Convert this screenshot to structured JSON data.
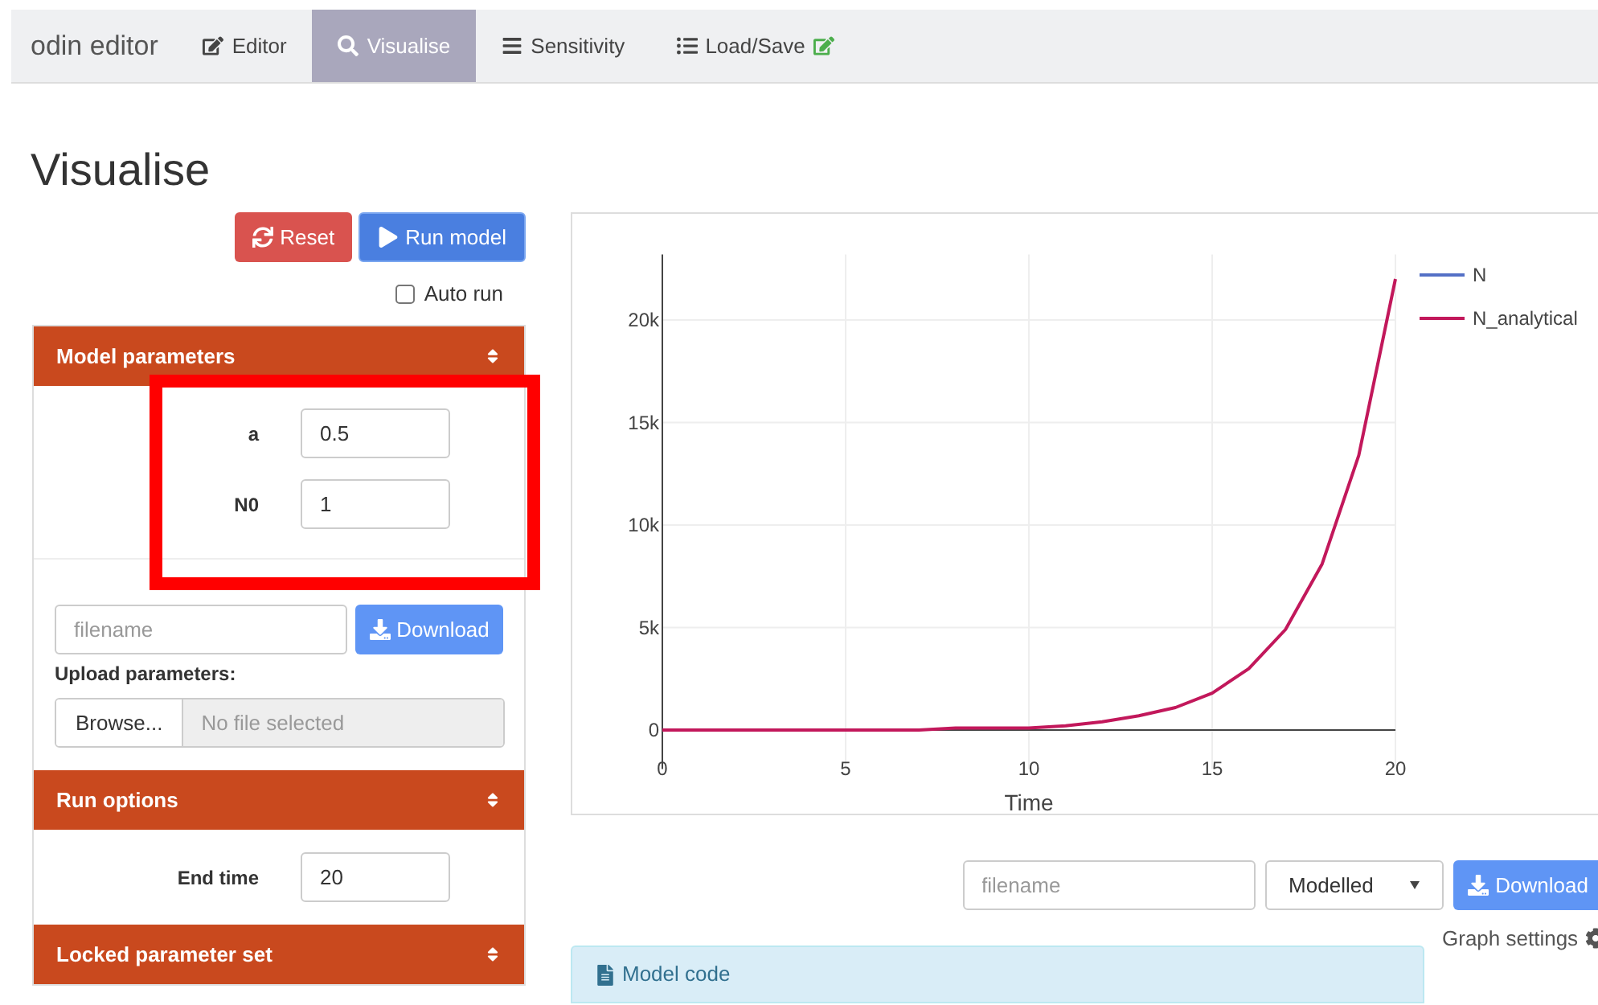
{
  "navbar": {
    "brand": "odin editor",
    "tabs": [
      {
        "label": "Editor",
        "selected": false
      },
      {
        "label": "Visualise",
        "selected": true
      },
      {
        "label": "Sensitivity",
        "selected": false
      },
      {
        "label": "Load/Save",
        "selected": false
      }
    ]
  },
  "page_title": "Visualise",
  "controls": {
    "reset": "Reset",
    "run": "Run model",
    "auto_run": {
      "label": "Auto run",
      "checked": false
    }
  },
  "model_parameters": {
    "title": "Model parameters",
    "params": [
      {
        "name": "a",
        "value": "0.5"
      },
      {
        "name": "N0",
        "value": "1"
      }
    ],
    "filename_placeholder": "filename",
    "download": "Download",
    "upload_label": "Upload parameters:",
    "browse": "Browse...",
    "no_file": "No file selected"
  },
  "run_options": {
    "title": "Run options",
    "end_time_label": "End time",
    "end_time": "20"
  },
  "locked_parameter_set": {
    "title": "Locked parameter set"
  },
  "chart_data": {
    "type": "line",
    "xlabel": "Time",
    "xlim": [
      0,
      20
    ],
    "ylim": [
      -1900,
      23200
    ],
    "grid": true,
    "legend": "right",
    "x": [
      0,
      1,
      2,
      3,
      4,
      5,
      6,
      7,
      8,
      9,
      10,
      11,
      12,
      13,
      14,
      15,
      16,
      17,
      18,
      19,
      20
    ],
    "xticks": [
      0,
      5,
      10,
      15,
      20
    ],
    "yticks": [
      {
        "value": 0,
        "label": "0"
      },
      {
        "value": 5000,
        "label": "5k"
      },
      {
        "value": 10000,
        "label": "10k"
      },
      {
        "value": 15000,
        "label": "15k"
      },
      {
        "value": 20000,
        "label": "20k"
      }
    ],
    "series": [
      {
        "name": "N",
        "color": "#5470c6",
        "values": [
          null,
          null,
          null,
          null,
          null,
          null,
          null,
          null,
          null,
          null,
          null,
          null,
          null,
          null,
          null,
          null,
          null,
          null,
          null,
          null,
          null
        ]
      },
      {
        "name": "N_analytical",
        "color": "#c2185b",
        "values": [
          0,
          0,
          0,
          0,
          0,
          0,
          0,
          0,
          100,
          100,
          100,
          200,
          400,
          700,
          1100,
          1800,
          3000,
          4900,
          8100,
          13400,
          22000
        ]
      }
    ]
  },
  "graph_controls": {
    "filename_placeholder": "filename",
    "series_select": "Modelled",
    "download": "Download",
    "graph_settings": "Graph settings"
  },
  "model_code": {
    "title": "Model code"
  }
}
